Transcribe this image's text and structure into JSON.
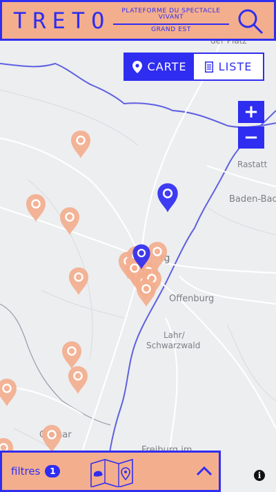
{
  "header": {
    "logo": "TRETO",
    "tagline_top": "PLATEFORME DU SPECTACLE",
    "tagline_mid": "VIVANT",
    "tagline_bottom": "GRAND EST"
  },
  "view_toggle": {
    "map_label": "CARTE",
    "list_label": "LISTE",
    "active": "map"
  },
  "zoom": {
    "in_label": "+",
    "out_label": "−"
  },
  "map": {
    "labels": {
      "der_platz": "der Platz",
      "rastatt": "Rastatt",
      "baden_baden": "Baden-Bad",
      "strasbourg": "rg",
      "offenburg": "Offenburg",
      "lahr": "Lahr/",
      "schwarzwald": "Schwarzwald",
      "colmar": "Colmar",
      "freiburg": "Freiburg im"
    }
  },
  "bottom_bar": {
    "filters_label": "filtres",
    "filter_count": "1"
  },
  "info": {
    "label": "i"
  },
  "colors": {
    "brand_blue": "#2f2df0",
    "brand_salmon": "#f3ae8e",
    "map_bg": "#eceef0",
    "marker_salmon": "#f3ae8e"
  }
}
